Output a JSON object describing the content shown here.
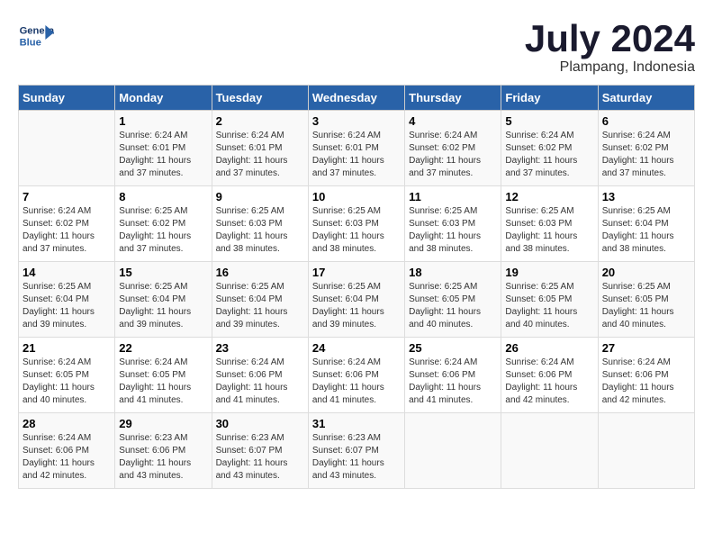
{
  "header": {
    "logo_line1": "General",
    "logo_line2": "Blue",
    "month_year": "July 2024",
    "location": "Plampang, Indonesia"
  },
  "weekdays": [
    "Sunday",
    "Monday",
    "Tuesday",
    "Wednesday",
    "Thursday",
    "Friday",
    "Saturday"
  ],
  "weeks": [
    [
      {
        "day": "",
        "info": ""
      },
      {
        "day": "1",
        "info": "Sunrise: 6:24 AM\nSunset: 6:01 PM\nDaylight: 11 hours\nand 37 minutes."
      },
      {
        "day": "2",
        "info": "Sunrise: 6:24 AM\nSunset: 6:01 PM\nDaylight: 11 hours\nand 37 minutes."
      },
      {
        "day": "3",
        "info": "Sunrise: 6:24 AM\nSunset: 6:01 PM\nDaylight: 11 hours\nand 37 minutes."
      },
      {
        "day": "4",
        "info": "Sunrise: 6:24 AM\nSunset: 6:02 PM\nDaylight: 11 hours\nand 37 minutes."
      },
      {
        "day": "5",
        "info": "Sunrise: 6:24 AM\nSunset: 6:02 PM\nDaylight: 11 hours\nand 37 minutes."
      },
      {
        "day": "6",
        "info": "Sunrise: 6:24 AM\nSunset: 6:02 PM\nDaylight: 11 hours\nand 37 minutes."
      }
    ],
    [
      {
        "day": "7",
        "info": "Sunrise: 6:24 AM\nSunset: 6:02 PM\nDaylight: 11 hours\nand 37 minutes."
      },
      {
        "day": "8",
        "info": "Sunrise: 6:25 AM\nSunset: 6:02 PM\nDaylight: 11 hours\nand 37 minutes."
      },
      {
        "day": "9",
        "info": "Sunrise: 6:25 AM\nSunset: 6:03 PM\nDaylight: 11 hours\nand 38 minutes."
      },
      {
        "day": "10",
        "info": "Sunrise: 6:25 AM\nSunset: 6:03 PM\nDaylight: 11 hours\nand 38 minutes."
      },
      {
        "day": "11",
        "info": "Sunrise: 6:25 AM\nSunset: 6:03 PM\nDaylight: 11 hours\nand 38 minutes."
      },
      {
        "day": "12",
        "info": "Sunrise: 6:25 AM\nSunset: 6:03 PM\nDaylight: 11 hours\nand 38 minutes."
      },
      {
        "day": "13",
        "info": "Sunrise: 6:25 AM\nSunset: 6:04 PM\nDaylight: 11 hours\nand 38 minutes."
      }
    ],
    [
      {
        "day": "14",
        "info": "Sunrise: 6:25 AM\nSunset: 6:04 PM\nDaylight: 11 hours\nand 39 minutes."
      },
      {
        "day": "15",
        "info": "Sunrise: 6:25 AM\nSunset: 6:04 PM\nDaylight: 11 hours\nand 39 minutes."
      },
      {
        "day": "16",
        "info": "Sunrise: 6:25 AM\nSunset: 6:04 PM\nDaylight: 11 hours\nand 39 minutes."
      },
      {
        "day": "17",
        "info": "Sunrise: 6:25 AM\nSunset: 6:04 PM\nDaylight: 11 hours\nand 39 minutes."
      },
      {
        "day": "18",
        "info": "Sunrise: 6:25 AM\nSunset: 6:05 PM\nDaylight: 11 hours\nand 40 minutes."
      },
      {
        "day": "19",
        "info": "Sunrise: 6:25 AM\nSunset: 6:05 PM\nDaylight: 11 hours\nand 40 minutes."
      },
      {
        "day": "20",
        "info": "Sunrise: 6:25 AM\nSunset: 6:05 PM\nDaylight: 11 hours\nand 40 minutes."
      }
    ],
    [
      {
        "day": "21",
        "info": "Sunrise: 6:24 AM\nSunset: 6:05 PM\nDaylight: 11 hours\nand 40 minutes."
      },
      {
        "day": "22",
        "info": "Sunrise: 6:24 AM\nSunset: 6:05 PM\nDaylight: 11 hours\nand 41 minutes."
      },
      {
        "day": "23",
        "info": "Sunrise: 6:24 AM\nSunset: 6:06 PM\nDaylight: 11 hours\nand 41 minutes."
      },
      {
        "day": "24",
        "info": "Sunrise: 6:24 AM\nSunset: 6:06 PM\nDaylight: 11 hours\nand 41 minutes."
      },
      {
        "day": "25",
        "info": "Sunrise: 6:24 AM\nSunset: 6:06 PM\nDaylight: 11 hours\nand 41 minutes."
      },
      {
        "day": "26",
        "info": "Sunrise: 6:24 AM\nSunset: 6:06 PM\nDaylight: 11 hours\nand 42 minutes."
      },
      {
        "day": "27",
        "info": "Sunrise: 6:24 AM\nSunset: 6:06 PM\nDaylight: 11 hours\nand 42 minutes."
      }
    ],
    [
      {
        "day": "28",
        "info": "Sunrise: 6:24 AM\nSunset: 6:06 PM\nDaylight: 11 hours\nand 42 minutes."
      },
      {
        "day": "29",
        "info": "Sunrise: 6:23 AM\nSunset: 6:06 PM\nDaylight: 11 hours\nand 43 minutes."
      },
      {
        "day": "30",
        "info": "Sunrise: 6:23 AM\nSunset: 6:07 PM\nDaylight: 11 hours\nand 43 minutes."
      },
      {
        "day": "31",
        "info": "Sunrise: 6:23 AM\nSunset: 6:07 PM\nDaylight: 11 hours\nand 43 minutes."
      },
      {
        "day": "",
        "info": ""
      },
      {
        "day": "",
        "info": ""
      },
      {
        "day": "",
        "info": ""
      }
    ]
  ]
}
